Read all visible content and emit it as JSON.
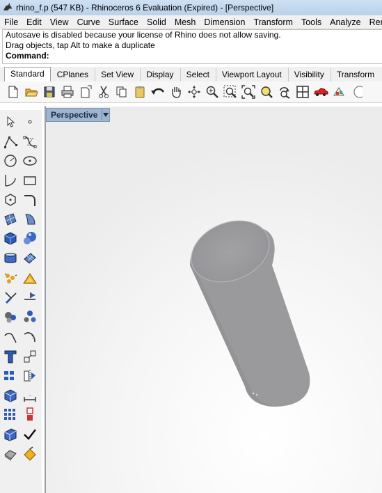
{
  "window": {
    "title": "rhino_f.p (547 KB) - Rhinoceros 6 Evaluation (Expired) - [Perspective]"
  },
  "menu": {
    "items": [
      "File",
      "Edit",
      "View",
      "Curve",
      "Surface",
      "Solid",
      "Mesh",
      "Dimension",
      "Transform",
      "Tools",
      "Analyze",
      "Ren"
    ]
  },
  "command": {
    "history": [
      "Autosave is disabled because your license of Rhino does not allow saving.",
      "Drag objects, tap Alt to make a duplicate"
    ],
    "prompt": "Command:",
    "value": ""
  },
  "tabs": {
    "items": [
      "Standard",
      "CPlanes",
      "Set View",
      "Display",
      "Select",
      "Viewport Layout",
      "Visibility",
      "Transform"
    ],
    "active": "Standard"
  },
  "toolbar": {
    "icons": [
      "new-icon",
      "open-icon",
      "save-icon",
      "print-icon",
      "import-icon",
      "cut-icon",
      "copy-icon",
      "paste-icon",
      "undo-icon",
      "pan-icon",
      "rotate-view-icon",
      "zoom-dynamic-icon",
      "zoom-window-icon",
      "zoom-extents-icon",
      "zoom-selected-icon",
      "rotate-camera-icon",
      "four-viewports-icon",
      "car-render-icon",
      "render-preview-icon"
    ]
  },
  "viewport": {
    "name": "Perspective",
    "object_color": "#9a9a9c"
  },
  "sidebar": {
    "icons": [
      [
        "select-arrow-icon",
        "point-icon"
      ],
      [
        "polyline-icon",
        "curve-icon"
      ],
      [
        "circle-icon",
        "ellipse-icon"
      ],
      [
        "arc-icon",
        "rectangle-icon"
      ],
      [
        "polygon-icon",
        "fillet-curve-icon"
      ],
      [
        "surface-points-icon",
        "surface-edge-icon"
      ],
      [
        "box-solid-icon",
        "sphere-solid-icon"
      ],
      [
        "mesh-cylinder-icon",
        "mesh-plane-icon"
      ],
      [
        "explode-icon",
        "boolean-icon"
      ],
      [
        "trim-icon",
        "split-icon"
      ],
      [
        "group-icon",
        "ungroup-icon"
      ],
      [
        "offset-curve-icon",
        "blend-curve-icon"
      ],
      [
        "text-icon",
        "scale-icon"
      ],
      [
        "array-icon",
        "mirror-icon"
      ],
      [
        "cage-icon",
        "dimension-icon"
      ],
      [
        "grid-array-icon",
        "move-icon"
      ],
      [
        "layer-icon",
        "check-icon"
      ],
      [
        "material-icon",
        "paint-icon"
      ]
    ]
  }
}
